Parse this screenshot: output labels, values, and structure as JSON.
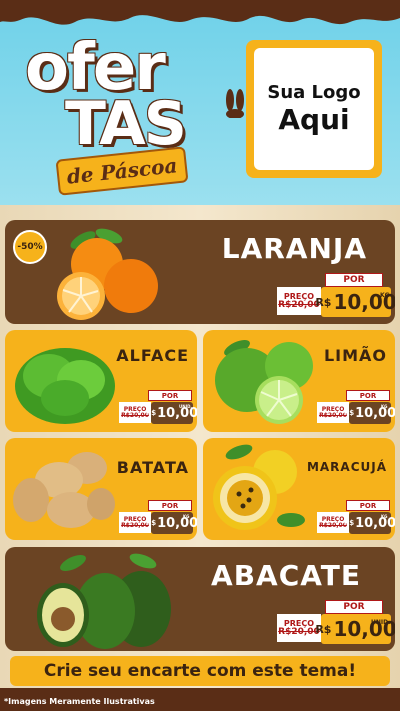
{
  "header": {
    "title_line1": "ofer",
    "title_line2": "TAS",
    "subtitle": "de Páscoa",
    "logo_line1": "Sua Logo",
    "logo_line2": "Aqui"
  },
  "colors": {
    "sky": "#6ed1e9",
    "chocolate": "#6b4423",
    "yellow": "#f6b21b",
    "price_red": "#b01818"
  },
  "products": [
    {
      "name": "LARANJA",
      "badge": "-50%",
      "por": "POR",
      "preco": "PREÇO",
      "old": "R$20,00",
      "currency": "R$",
      "price": "10,00",
      "unit": "KG"
    },
    {
      "name": "ALFACE",
      "por": "POR",
      "preco": "PREÇO",
      "old": "R$20,00",
      "currency": "R$",
      "price": "10,00",
      "unit": "UNID."
    },
    {
      "name": "LIMÃO",
      "por": "POR",
      "preco": "PREÇO",
      "old": "R$20,00",
      "currency": "R$",
      "price": "10,00",
      "unit": "KG"
    },
    {
      "name": "BATATA",
      "por": "POR",
      "preco": "PREÇO",
      "old": "R$20,00",
      "currency": "R$",
      "price": "10,00",
      "unit": "KG"
    },
    {
      "name": "MARACUJÁ",
      "por": "POR",
      "preco": "PREÇO",
      "old": "R$20,00",
      "currency": "R$",
      "price": "10,00",
      "unit": "KG"
    },
    {
      "name": "ABACATE",
      "por": "POR",
      "preco": "PREÇO",
      "old": "R$20,00",
      "currency": "R$",
      "price": "10,00",
      "unit": "UNID."
    }
  ],
  "cta": "Crie seu encarte com este tema!",
  "disclaimer": "*Imagens Meramente Ilustrativas"
}
